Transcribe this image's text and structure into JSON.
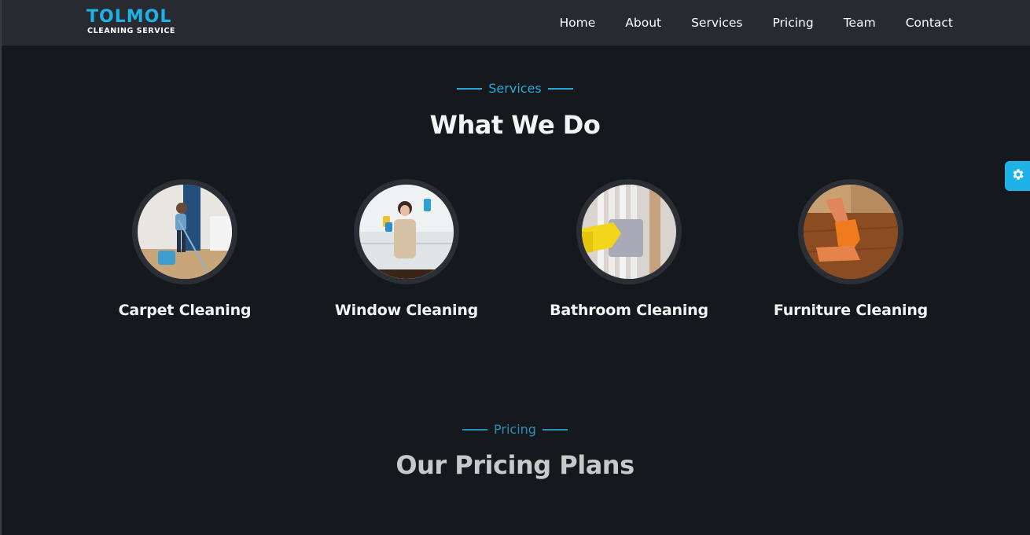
{
  "brand": {
    "name": "TOLMOL",
    "tagline": "CLEANING SERVICE"
  },
  "nav": {
    "items": [
      {
        "label": "Home"
      },
      {
        "label": "About"
      },
      {
        "label": "Services"
      },
      {
        "label": "Pricing"
      },
      {
        "label": "Team"
      },
      {
        "label": "Contact"
      }
    ]
  },
  "services_section": {
    "tag": "Services",
    "title": "What We Do",
    "items": [
      {
        "label": "Carpet Cleaning",
        "image": "woman-mopping-floor"
      },
      {
        "label": "Window Cleaning",
        "image": "woman-cleaning-window"
      },
      {
        "label": "Bathroom Cleaning",
        "image": "gloved-hand-cleaning-radiator"
      },
      {
        "label": "Furniture Cleaning",
        "image": "gloved-hand-wiping-table"
      }
    ]
  },
  "pricing_section": {
    "tag": "Pricing",
    "title": "Our Pricing Plans"
  },
  "settings_button": {
    "icon": "gear-icon"
  },
  "colors": {
    "accent": "#1eb2e6",
    "header_bg": "#272b31",
    "page_bg": "#15181c",
    "ring_bg": "#2b2f35"
  }
}
